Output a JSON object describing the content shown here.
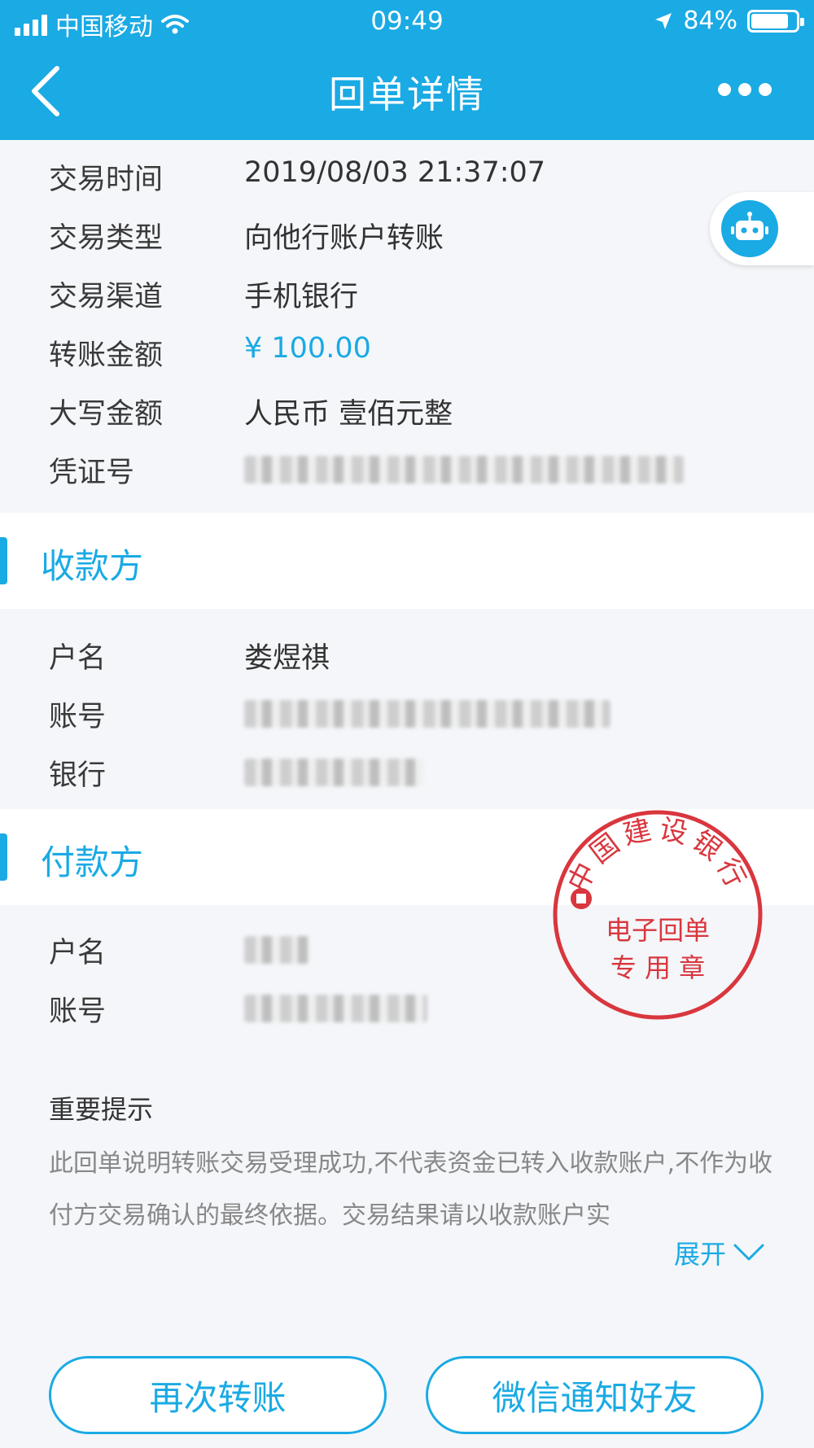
{
  "status_bar": {
    "carrier": "中国移动",
    "time": "09:49",
    "battery": "84%",
    "battery_level": 0.84
  },
  "nav": {
    "title": "回单详情"
  },
  "transaction": {
    "rows": [
      {
        "label": "交易时间",
        "value": "2019/08/03 21:37:07"
      },
      {
        "label": "交易类型",
        "value": "向他行账户转账"
      },
      {
        "label": "交易渠道",
        "value": "手机银行"
      },
      {
        "label": "转账金额",
        "value": "¥ 100.00"
      },
      {
        "label": "大写金额",
        "value": "人民币 壹佰元整"
      },
      {
        "label": "凭证号",
        "value": ""
      }
    ]
  },
  "payee": {
    "title": "收款方",
    "rows": [
      {
        "label": "户名",
        "value": "娄煜祺"
      },
      {
        "label": "账号",
        "value": ""
      },
      {
        "label": "银行",
        "value": ""
      }
    ]
  },
  "payer": {
    "title": "付款方",
    "rows": [
      {
        "label": "户名",
        "value": ""
      },
      {
        "label": "账号",
        "value": ""
      }
    ]
  },
  "stamp": {
    "bank": "中国建设银行",
    "line1": "电子回单",
    "line2": "专 用 章",
    "color": "#d9363e"
  },
  "notice": {
    "title": "重要提示",
    "body": "此回单说明转账交易受理成功,不代表资金已转入收款账户,不作为收付方交易确认的最终依据。交易结果请以收款账户实",
    "expand_label": "展开"
  },
  "buttons": {
    "transfer_again": "再次转账",
    "wechat_notify": "微信通知好友"
  },
  "colors": {
    "accent": "#1aaae4"
  }
}
